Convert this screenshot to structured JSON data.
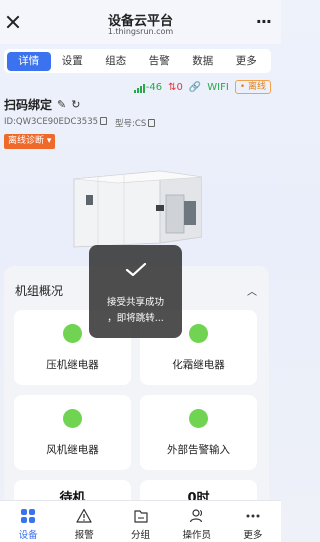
{
  "header": {
    "title": "设备云平台",
    "subtitle": "1.thingsrun.com",
    "more": "···"
  },
  "tabs": [
    {
      "label": "详情",
      "active": true
    },
    {
      "label": "设置"
    },
    {
      "label": "组态"
    },
    {
      "label": "告警"
    },
    {
      "label": "数据"
    },
    {
      "label": "更多"
    }
  ],
  "status": {
    "signal": "-46",
    "errors": "0",
    "wifi": "WIFI",
    "state": "• 离线"
  },
  "device": {
    "name": "扫码绑定",
    "id": "ID:QW3CE90EDC3535",
    "model": "型号:CS",
    "diag_button": "离线诊断 ▾"
  },
  "overview": {
    "title": "机组概况",
    "tiles": [
      {
        "label": "压机继电器"
      },
      {
        "label": "化霜继电器"
      },
      {
        "label": "风机继电器"
      },
      {
        "label": "外部告警输入"
      },
      {
        "label": "待机"
      },
      {
        "label": "0时"
      }
    ]
  },
  "toast": {
    "line1": "接受共享成功",
    "line2": "，即将跳转..."
  },
  "bottom_nav": [
    {
      "label": "设备",
      "icon": "grid-icon",
      "active": true
    },
    {
      "label": "报警",
      "icon": "warning-icon"
    },
    {
      "label": "分组",
      "icon": "folder-icon"
    },
    {
      "label": "操作员",
      "icon": "users-icon"
    },
    {
      "label": "更多",
      "icon": "more-icon"
    }
  ],
  "colors": {
    "accent": "#3a72f0",
    "status_green": "#70d452",
    "alert_orange": "#ef6a2a"
  }
}
